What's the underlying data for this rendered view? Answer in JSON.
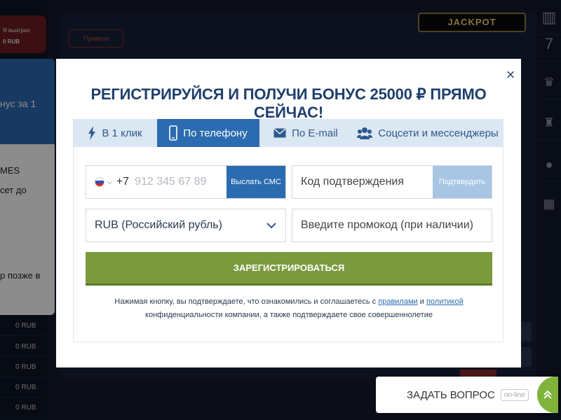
{
  "background": {
    "win_label": "Я выиграл",
    "win_amount": "0 RUB",
    "rub_rows": [
      "0 RUB",
      "0 RUB",
      "0 RUB",
      "0 RUB",
      "0 RUB"
    ],
    "rules_button": "Правила",
    "jackpot": "JACKPOT",
    "card_text_1": "нус за 1",
    "card_text_2": "MES",
    "card_text_3": "сет до",
    "card_text_4": "р позже в",
    "right_icons": [
      "gift-icon",
      "seven-icon",
      "trophy-cup-icon",
      "trophy-icon",
      "coin-icon",
      "ticket-icon"
    ]
  },
  "modal": {
    "close_label": "×",
    "title": "РЕГИСТРИРУЙСЯ И ПОЛУЧИ БОНУС 25000 ₽ ПРЯМО СЕЙЧАС!",
    "tabs": [
      {
        "label": "В 1 клик",
        "icon": "lightning-icon"
      },
      {
        "label": "По телефону",
        "icon": "phone-icon"
      },
      {
        "label": "По E-mail",
        "icon": "envelope-icon"
      },
      {
        "label": "Соцсети и мессенджеры",
        "icon": "people-icon"
      }
    ],
    "active_tab": "По телефону",
    "phone": {
      "prefix": "+7",
      "placeholder": "912 345 67 89",
      "send_sms": "Выслать СМС"
    },
    "code": {
      "placeholder": "Код подтверждения",
      "confirm": "Подтвердить"
    },
    "currency": {
      "value": "RUB (Российский рубль)"
    },
    "promo": {
      "placeholder": "Введите промокод (при наличии)"
    },
    "register_label": "ЗАРЕГИСТРИРОВАТЬСЯ",
    "terms": {
      "part1": "Нажимая кнопку, вы подтверждаете, что ознакомились и соглашаетесь с ",
      "rules_link": "правилами",
      "and": " и ",
      "policy_link": "политикой",
      "part2": " конфиденциальности компании, а также подтверждаете свое совершеннолетие"
    }
  },
  "ask_widget": {
    "label": "ЗАДАТЬ ВОПРОС",
    "badge": "on-line"
  },
  "colors": {
    "accent_blue": "#2b6cb0",
    "title_blue": "#1f3f6e",
    "register_green": "#7b9a3d",
    "confirm_disabled": "#a8c6e4"
  }
}
